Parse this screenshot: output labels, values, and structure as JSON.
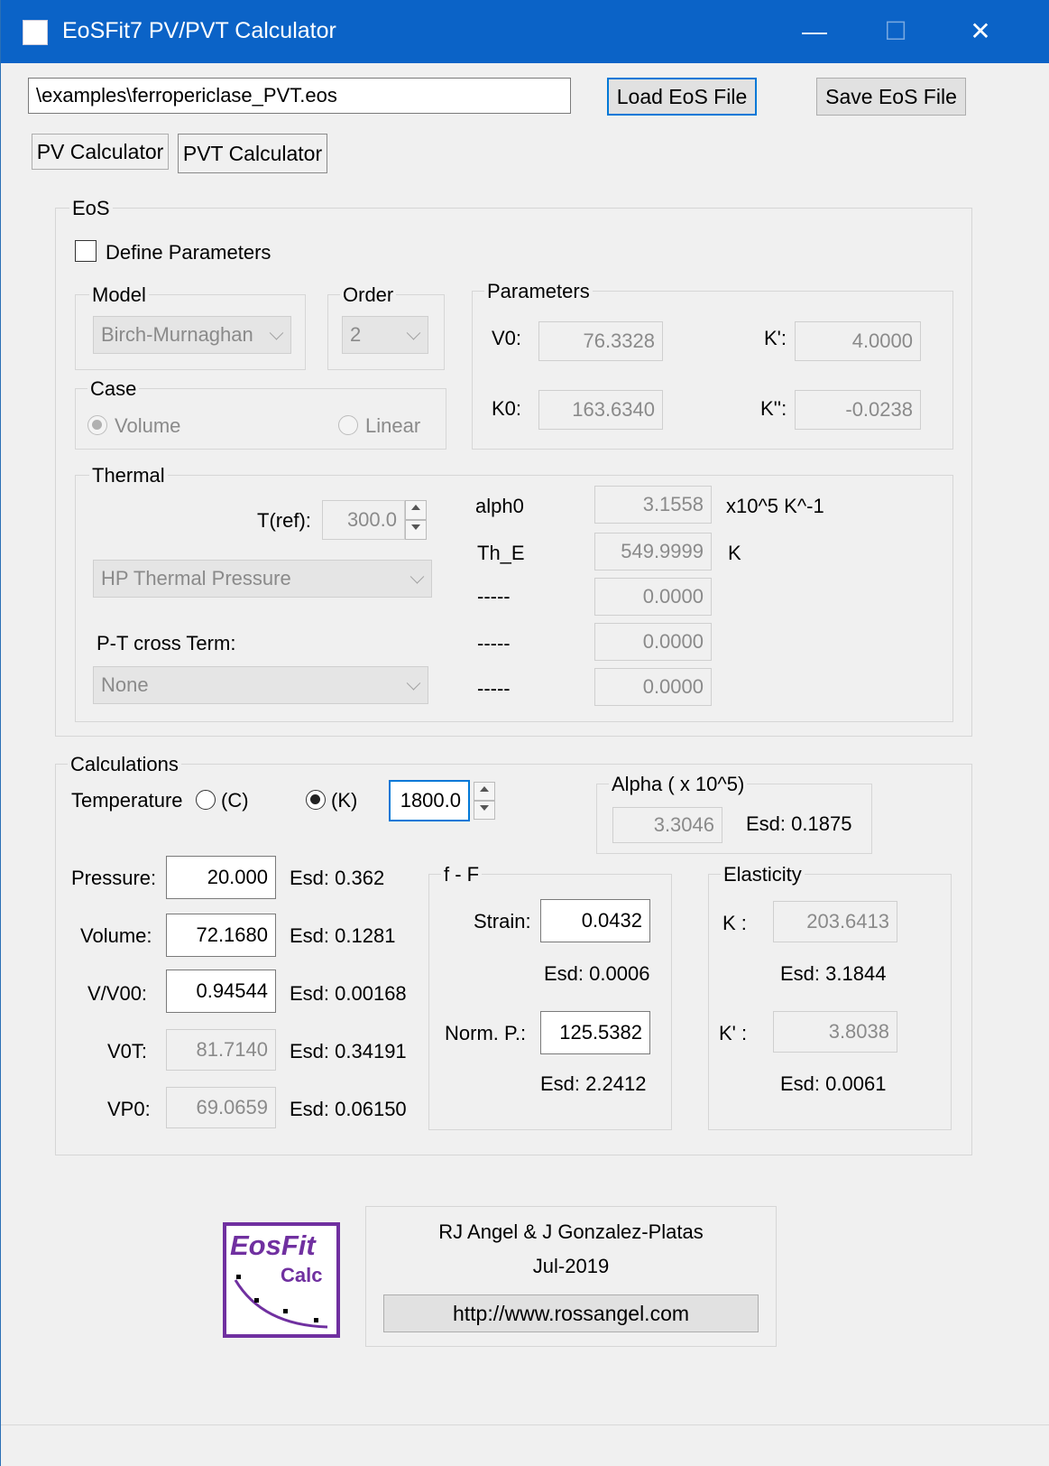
{
  "window": {
    "title": "EoSFit7 PV/PVT Calculator",
    "min": "—",
    "max": "☐",
    "close": "✕"
  },
  "file": {
    "path": "\\examples\\ferropericlase_PVT.eos",
    "load": "Load EoS File",
    "save": "Save EoS File"
  },
  "tabs": [
    "PV Calculator",
    "PVT Calculator"
  ],
  "eos": {
    "title": "EoS",
    "define": "Define Parameters",
    "model_label": "Model",
    "model_value": "Birch-Murnaghan",
    "order_label": "Order",
    "order_value": "2",
    "case_label": "Case",
    "volume": "Volume",
    "linear": "Linear",
    "params_label": "Parameters",
    "v0_label": "V0:",
    "v0": "76.3328",
    "kp_label": "K':",
    "kp": "4.0000",
    "k0_label": "K0:",
    "k0": "163.6340",
    "kpp_label": "K'':",
    "kpp": "-0.0238"
  },
  "thermal": {
    "title": "Thermal",
    "tref_label": "T(ref):",
    "tref": "300.0",
    "model": "HP Thermal Pressure",
    "cross_label": "P-T cross Term:",
    "cross": "None",
    "rows": [
      {
        "label": "alph0",
        "value": "3.1558",
        "unit": "x10^5 K^-1"
      },
      {
        "label": "Th_E",
        "value": "549.9999",
        "unit": "K"
      },
      {
        "label": "-----",
        "value": "0.0000",
        "unit": ""
      },
      {
        "label": "-----",
        "value": "0.0000",
        "unit": ""
      },
      {
        "label": "-----",
        "value": "0.0000",
        "unit": ""
      }
    ]
  },
  "calc": {
    "title": "Calculations",
    "temp_label": "Temperature",
    "c": "(C)",
    "k": "(K)",
    "temp": "1800.0",
    "alpha_title": "Alpha ( x 10^5)",
    "alpha": "3.3046",
    "alpha_esd": "Esd: 0.1875",
    "rows": [
      {
        "label": "Pressure:",
        "value": "20.000",
        "esd": "Esd: 0.362"
      },
      {
        "label": "Volume:",
        "value": "72.1680",
        "esd": "Esd: 0.1281"
      },
      {
        "label": "V/V00:",
        "value": "0.94544",
        "esd": "Esd: 0.00168"
      },
      {
        "label": "V0T:",
        "value": "81.7140",
        "esd": "Esd: 0.34191"
      },
      {
        "label": "VP0:",
        "value": "69.0659",
        "esd": "Esd: 0.06150"
      }
    ],
    "ff_title": "f - F",
    "strain_label": "Strain:",
    "strain": "0.0432",
    "strain_esd": "Esd: 0.0006",
    "normp_label": "Norm. P.:",
    "normp": "125.5382",
    "normp_esd": "Esd: 2.2412",
    "el_title": "Elasticity",
    "k_label": "K :",
    "k_val": "203.6413",
    "k_esd": "Esd: 3.1844",
    "kp_label": "K' :",
    "kp_val": "3.8038",
    "kp_esd": "Esd: 0.0061"
  },
  "footer": {
    "authors": "RJ Angel   &   J Gonzalez-Platas",
    "date": "Jul-2019",
    "url": "http://www.rossangel.com",
    "logo1": "EosFit",
    "logo2": "Calc"
  }
}
